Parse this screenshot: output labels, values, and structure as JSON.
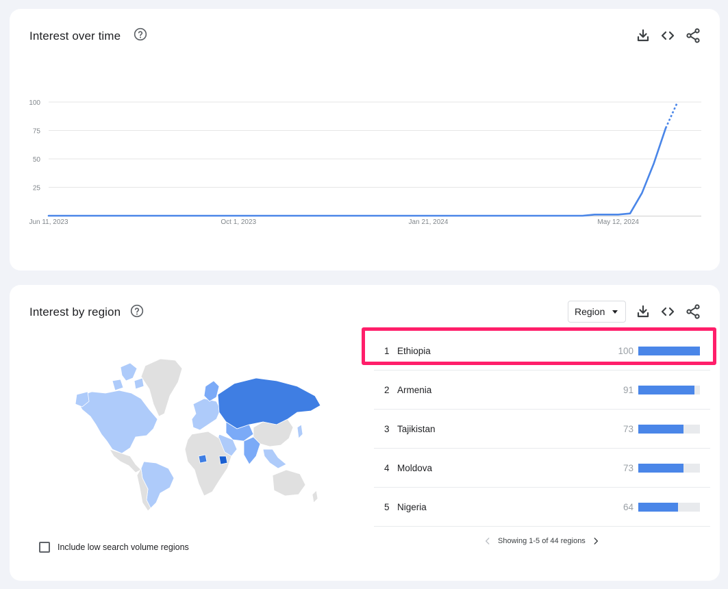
{
  "interest_over_time": {
    "title": "Interest over time",
    "icons": [
      "help-icon",
      "download-icon",
      "embed-code-icon",
      "share-icon"
    ],
    "chart_data": {
      "type": "line",
      "y_ticks": [
        25,
        50,
        75,
        100
      ],
      "ylim": [
        0,
        100
      ],
      "x_tick_labels": [
        "Jun 11, 2023",
        "Oct 1, 2023",
        "Jan 21, 2024",
        "May 12, 2024"
      ],
      "xlim": [
        "2023-06-11",
        "2024-06-30"
      ],
      "series": [
        {
          "color": "#4a86e8",
          "points": [
            {
              "x": "2023-06-11",
              "y": 0
            },
            {
              "x": "2024-04-21",
              "y": 0
            },
            {
              "x": "2024-04-28",
              "y": 1
            },
            {
              "x": "2024-05-12",
              "y": 1
            },
            {
              "x": "2024-05-19",
              "y": 2
            },
            {
              "x": "2024-05-26",
              "y": 20
            },
            {
              "x": "2024-06-02",
              "y": 46
            },
            {
              "x": "2024-06-09",
              "y": 77
            }
          ],
          "partial": [
            {
              "x": "2024-06-09",
              "y": 77
            },
            {
              "x": "2024-06-16",
              "y": 100
            }
          ]
        }
      ]
    }
  },
  "interest_by_region": {
    "title": "Interest by region",
    "dropdown": {
      "selected": "Region"
    },
    "icons": [
      "help-icon",
      "download-icon",
      "embed-code-icon",
      "share-icon"
    ],
    "regions": [
      {
        "rank": "1",
        "name": "Ethiopia",
        "value": 100
      },
      {
        "rank": "2",
        "name": "Armenia",
        "value": 91
      },
      {
        "rank": "3",
        "name": "Tajikistan",
        "value": 73
      },
      {
        "rank": "4",
        "name": "Moldova",
        "value": 73
      },
      {
        "rank": "5",
        "name": "Nigeria",
        "value": 64
      }
    ],
    "checkbox_label": "Include low search volume regions",
    "pagination": "Showing 1-5 of 44 regions",
    "colors": {
      "strong": "#3f7ee3",
      "medium": "#7baaf7",
      "light": "#aecbfa",
      "none": "#e0e0e0",
      "highlight": "#ff1e6a"
    }
  }
}
